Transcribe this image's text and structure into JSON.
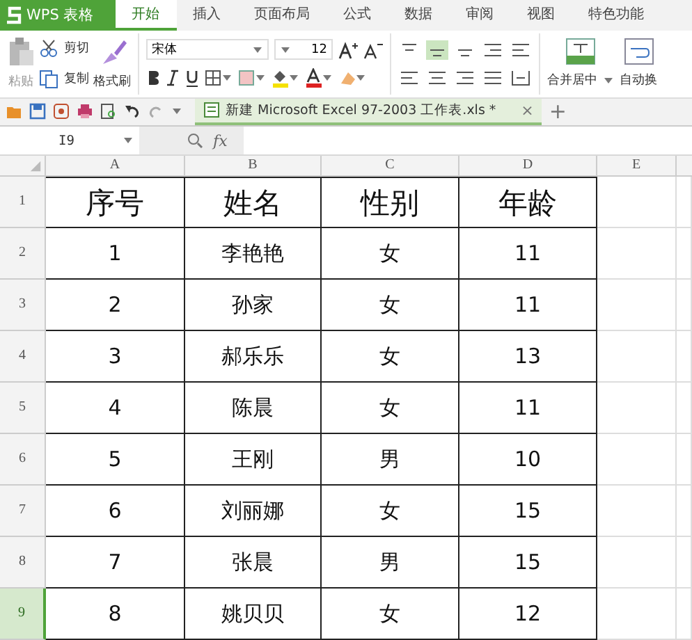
{
  "app": {
    "title": "WPS 表格"
  },
  "ribbon": {
    "tabs": [
      {
        "label": "开始",
        "selected": true
      },
      {
        "label": "插入",
        "selected": false
      },
      {
        "label": "页面布局",
        "selected": false
      },
      {
        "label": "公式",
        "selected": false
      },
      {
        "label": "数据",
        "selected": false
      },
      {
        "label": "审阅",
        "selected": false
      },
      {
        "label": "视图",
        "selected": false
      },
      {
        "label": "特色功能",
        "selected": false
      }
    ]
  },
  "toolbar": {
    "paste": "粘贴",
    "cut": "剪切",
    "copy": "复制",
    "format_painter": "格式刷",
    "font": "宋体",
    "font_size": "12",
    "merge": "合并居中",
    "wrap": "自动换"
  },
  "document_tab": {
    "title": "新建 Microsoft Excel 97-2003 工作表.xls *",
    "close": "×",
    "add": "+"
  },
  "formula_bar": {
    "name_box": "I9",
    "fx": "fx"
  },
  "sheet": {
    "columns": [
      "A",
      "B",
      "C",
      "D",
      "E"
    ],
    "rows": [
      {
        "number": "1",
        "selected": false,
        "kind": "header",
        "cells": [
          "序号",
          "姓名",
          "性别",
          "年龄"
        ]
      },
      {
        "number": "2",
        "selected": false,
        "kind": "data",
        "cells": [
          "1",
          "李艳艳",
          "女",
          "11"
        ]
      },
      {
        "number": "3",
        "selected": false,
        "kind": "data",
        "cells": [
          "2",
          "孙家",
          "女",
          "11"
        ]
      },
      {
        "number": "4",
        "selected": false,
        "kind": "data",
        "cells": [
          "3",
          "郝乐乐",
          "女",
          "13"
        ]
      },
      {
        "number": "5",
        "selected": false,
        "kind": "data",
        "cells": [
          "4",
          "陈晨",
          "女",
          "11"
        ]
      },
      {
        "number": "6",
        "selected": false,
        "kind": "data",
        "cells": [
          "5",
          "王刚",
          "男",
          "10"
        ]
      },
      {
        "number": "7",
        "selected": false,
        "kind": "data",
        "cells": [
          "6",
          "刘丽娜",
          "女",
          "15"
        ]
      },
      {
        "number": "8",
        "selected": false,
        "kind": "data",
        "cells": [
          "7",
          "张晨",
          "男",
          "15"
        ]
      },
      {
        "number": "9",
        "selected": true,
        "kind": "data",
        "cells": [
          "8",
          "姚贝贝",
          "女",
          "12"
        ]
      }
    ]
  }
}
